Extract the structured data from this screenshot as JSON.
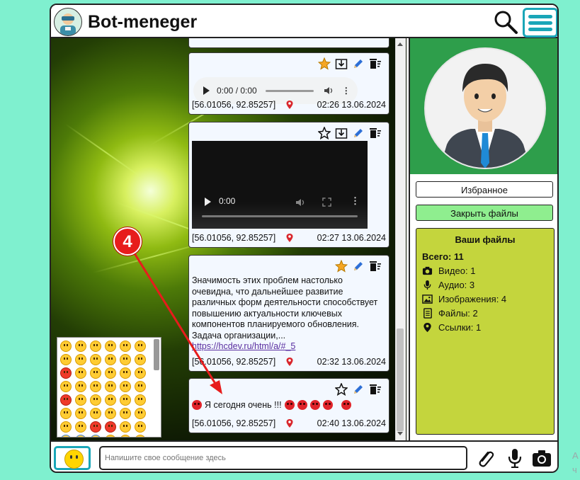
{
  "app": {
    "title": "Bot-meneger"
  },
  "messages": [
    {
      "type": "audio",
      "audio_time": "0:00 / 0:00",
      "coords": "[56.01056, 92.85257]",
      "time": "02:26 13.06.2024",
      "starred": true
    },
    {
      "type": "video",
      "video_time": "0:00",
      "coords": "[56.01056, 92.85257]",
      "time": "02:27 13.06.2024",
      "starred": false
    },
    {
      "type": "text",
      "text": "Значимость этих проблем настолько очевидна, что дальнейшее развитие различных форм деятельности способствует повышению актуальности ключевых компонентов планируемого обновления. Задача организации,...",
      "link": "https://hcdev.ru/html/a/#_5",
      "coords": "[56.01056, 92.85257]",
      "time": "02:32 13.06.2024",
      "starred": true
    },
    {
      "type": "emoji-text",
      "text": "Я сегодня очень !!!",
      "coords": "[56.01056, 92.85257]",
      "time": "02:40 13.06.2024",
      "starred": false
    }
  ],
  "sidebar": {
    "favorites_label": "Избранное",
    "close_files_label": "Закрыть файлы",
    "files": {
      "title": "Ваши файлы",
      "total": "Всего: 11",
      "rows": [
        {
          "icon": "camera-icon",
          "label": "Видео: 1"
        },
        {
          "icon": "microphone-icon",
          "label": "Аудио: 3"
        },
        {
          "icon": "image-icon",
          "label": "Изображения: 4"
        },
        {
          "icon": "document-icon",
          "label": "Файлы: 2"
        },
        {
          "icon": "location-pin-icon",
          "label": "Ссылки: 1"
        }
      ]
    }
  },
  "input": {
    "placeholder": "Напишите свое сообщение здесь"
  },
  "annotation": {
    "label": "4"
  },
  "edge_text": "А ч",
  "colors": {
    "accent": "#1aa6b8",
    "background": "#7ff0cf",
    "files_panel": "#c4d53d",
    "annotation": "#e71c1c"
  }
}
